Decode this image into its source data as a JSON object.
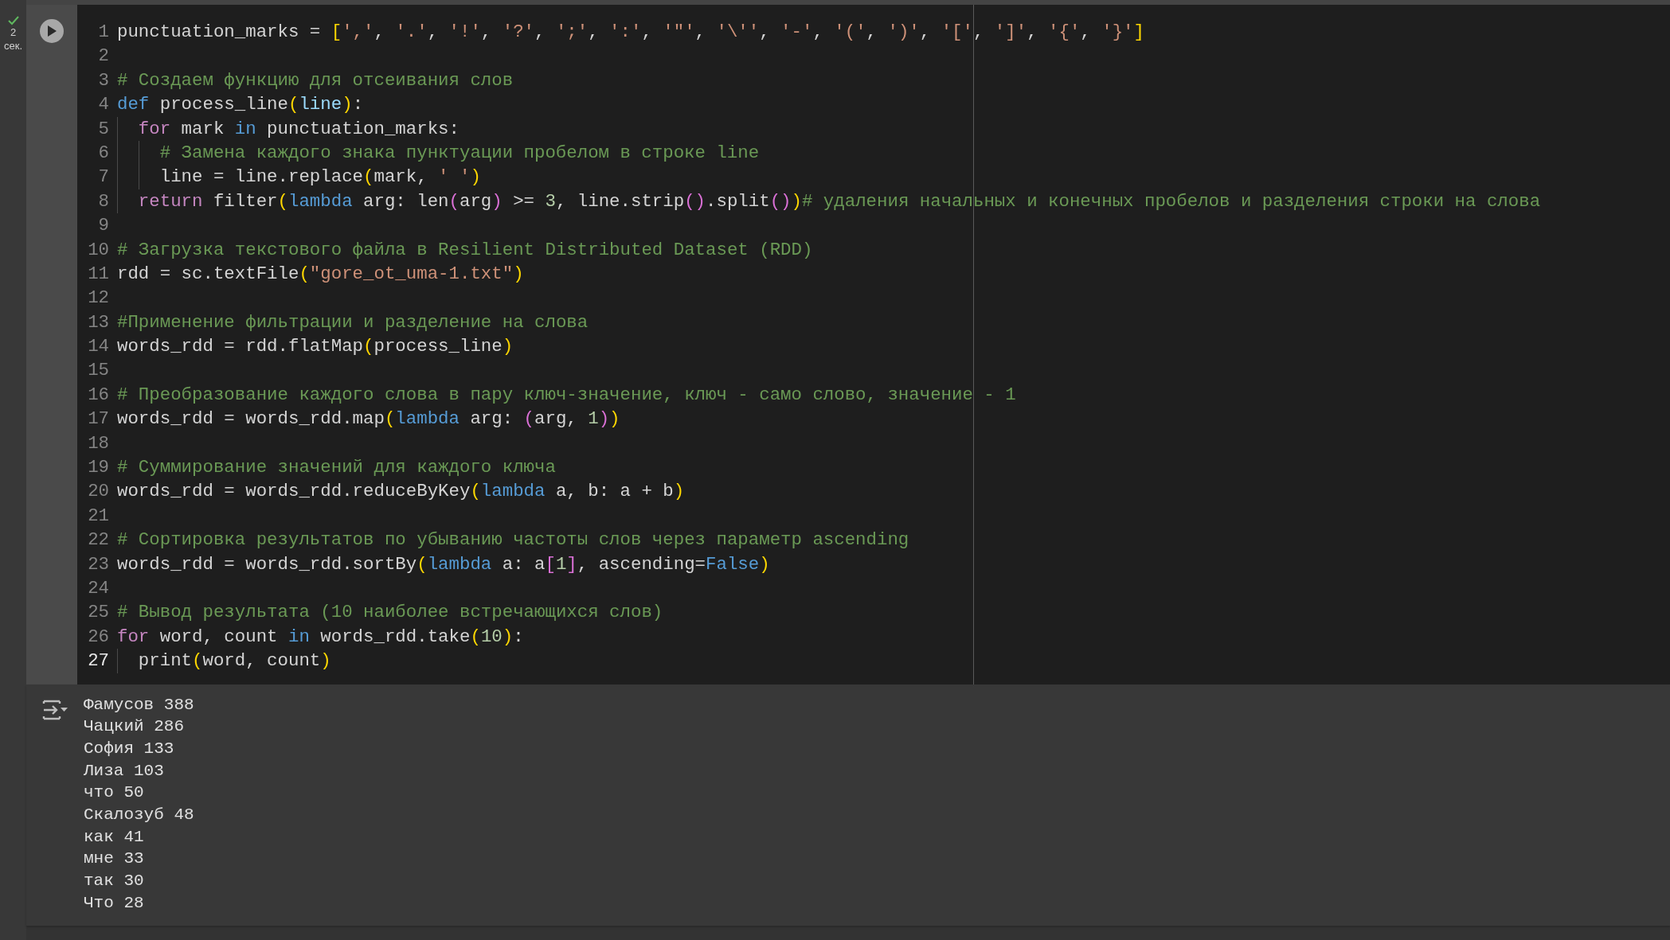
{
  "cell": {
    "status": {
      "done": true,
      "duration": "2",
      "unit": "сек."
    },
    "code_lines": [
      {
        "number": "1",
        "current": false,
        "tokens": [
          {
            "kind": "plain",
            "text": "punctuation_marks = "
          },
          {
            "kind": "bracket1",
            "text": "["
          },
          {
            "kind": "string",
            "text": "','"
          },
          {
            "kind": "plain",
            "text": ", "
          },
          {
            "kind": "string",
            "text": "'.'"
          },
          {
            "kind": "plain",
            "text": ", "
          },
          {
            "kind": "string",
            "text": "'!'"
          },
          {
            "kind": "plain",
            "text": ", "
          },
          {
            "kind": "string",
            "text": "'?'"
          },
          {
            "kind": "plain",
            "text": ", "
          },
          {
            "kind": "string",
            "text": "';'"
          },
          {
            "kind": "plain",
            "text": ", "
          },
          {
            "kind": "string",
            "text": "':'"
          },
          {
            "kind": "plain",
            "text": ", "
          },
          {
            "kind": "string",
            "text": "'\"'"
          },
          {
            "kind": "plain",
            "text": ", "
          },
          {
            "kind": "string",
            "text": "'\\''"
          },
          {
            "kind": "plain",
            "text": ", "
          },
          {
            "kind": "string",
            "text": "'-'"
          },
          {
            "kind": "plain",
            "text": ", "
          },
          {
            "kind": "string",
            "text": "'('"
          },
          {
            "kind": "plain",
            "text": ", "
          },
          {
            "kind": "string",
            "text": "')'"
          },
          {
            "kind": "plain",
            "text": ", "
          },
          {
            "kind": "string",
            "text": "'['"
          },
          {
            "kind": "plain",
            "text": ", "
          },
          {
            "kind": "string",
            "text": "']'"
          },
          {
            "kind": "plain",
            "text": ", "
          },
          {
            "kind": "string",
            "text": "'{'"
          },
          {
            "kind": "plain",
            "text": ", "
          },
          {
            "kind": "string",
            "text": "'}'"
          },
          {
            "kind": "bracket1",
            "text": "]"
          }
        ]
      },
      {
        "number": "2",
        "current": false
      },
      {
        "number": "3",
        "current": false,
        "tokens": [
          {
            "kind": "comment",
            "text": "# Создаем функцию для отсеивания слов"
          }
        ]
      },
      {
        "number": "4",
        "current": false,
        "tokens": [
          {
            "kind": "keyword2",
            "text": "def"
          },
          {
            "kind": "plain",
            "text": " process_line"
          },
          {
            "kind": "bracket1",
            "text": "("
          },
          {
            "kind": "param",
            "text": "line"
          },
          {
            "kind": "bracket1",
            "text": ")"
          },
          {
            "kind": "plain",
            "text": ":"
          }
        ]
      },
      {
        "number": "5",
        "current": false,
        "tokens": [
          {
            "kind": "keyword1",
            "text": "  for"
          },
          {
            "kind": "plain",
            "text": " mark "
          },
          {
            "kind": "keyword2",
            "text": "in"
          },
          {
            "kind": "plain",
            "text": " punctuation_marks:"
          }
        ]
      },
      {
        "number": "6",
        "current": false,
        "tokens": [
          {
            "kind": "comment",
            "text": "    # Замена каждого знака пунктуации пробелом в строке line"
          }
        ]
      },
      {
        "number": "7",
        "current": false,
        "tokens": [
          {
            "kind": "plain",
            "text": "    line = line.replace"
          },
          {
            "kind": "bracket1",
            "text": "("
          },
          {
            "kind": "plain",
            "text": "mark, "
          },
          {
            "kind": "string",
            "text": "' '"
          },
          {
            "kind": "bracket1",
            "text": ")"
          }
        ]
      },
      {
        "number": "8",
        "current": false,
        "tokens": [
          {
            "kind": "keyword1",
            "text": "  return"
          },
          {
            "kind": "plain",
            "text": " filter"
          },
          {
            "kind": "bracket1",
            "text": "("
          },
          {
            "kind": "keyword2",
            "text": "lambda"
          },
          {
            "kind": "plain",
            "text": " arg: len"
          },
          {
            "kind": "bracket2",
            "text": "("
          },
          {
            "kind": "plain",
            "text": "arg"
          },
          {
            "kind": "bracket2",
            "text": ")"
          },
          {
            "kind": "plain",
            "text": " >= "
          },
          {
            "kind": "number",
            "text": "3"
          },
          {
            "kind": "plain",
            "text": ", line.strip"
          },
          {
            "kind": "bracket2",
            "text": "()"
          },
          {
            "kind": "plain",
            "text": ".split"
          },
          {
            "kind": "bracket2",
            "text": "()"
          },
          {
            "kind": "bracket1",
            "text": ")"
          },
          {
            "kind": "comment",
            "text": "# удаления начальных и конечных пробелов и разделения строки на слова"
          }
        ]
      },
      {
        "number": "9",
        "current": false
      },
      {
        "number": "10",
        "current": false,
        "tokens": [
          {
            "kind": "comment",
            "text": "# Загрузка текстового файла в Resilient Distributed Dataset (RDD)"
          }
        ]
      },
      {
        "number": "11",
        "current": false,
        "tokens": [
          {
            "kind": "plain",
            "text": "rdd = sc.textFile"
          },
          {
            "kind": "bracket1",
            "text": "("
          },
          {
            "kind": "string",
            "text": "\"gore_ot_uma-1.txt\""
          },
          {
            "kind": "bracket1",
            "text": ")"
          }
        ]
      },
      {
        "number": "12",
        "current": false
      },
      {
        "number": "13",
        "current": false,
        "tokens": [
          {
            "kind": "comment",
            "text": "#Применение фильтрации и разделение на слова"
          }
        ]
      },
      {
        "number": "14",
        "current": false,
        "tokens": [
          {
            "kind": "plain",
            "text": "words_rdd = rdd.flatMap"
          },
          {
            "kind": "bracket1",
            "text": "("
          },
          {
            "kind": "plain",
            "text": "process_line"
          },
          {
            "kind": "bracket1",
            "text": ")"
          }
        ]
      },
      {
        "number": "15",
        "current": false
      },
      {
        "number": "16",
        "current": false,
        "tokens": [
          {
            "kind": "comment",
            "text": "# Преобразование каждого слова в пару ключ-значение, ключ - само слово, значение - 1"
          }
        ]
      },
      {
        "number": "17",
        "current": false,
        "tokens": [
          {
            "kind": "plain",
            "text": "words_rdd = words_rdd.map"
          },
          {
            "kind": "bracket1",
            "text": "("
          },
          {
            "kind": "keyword2",
            "text": "lambda"
          },
          {
            "kind": "plain",
            "text": " arg: "
          },
          {
            "kind": "bracket2",
            "text": "("
          },
          {
            "kind": "plain",
            "text": "arg, "
          },
          {
            "kind": "number",
            "text": "1"
          },
          {
            "kind": "bracket2",
            "text": ")"
          },
          {
            "kind": "bracket1",
            "text": ")"
          }
        ]
      },
      {
        "number": "18",
        "current": false
      },
      {
        "number": "19",
        "current": false,
        "tokens": [
          {
            "kind": "comment",
            "text": "# Суммирование значений для каждого ключа"
          }
        ]
      },
      {
        "number": "20",
        "current": false,
        "tokens": [
          {
            "kind": "plain",
            "text": "words_rdd = words_rdd.reduceByKey"
          },
          {
            "kind": "bracket1",
            "text": "("
          },
          {
            "kind": "keyword2",
            "text": "lambda"
          },
          {
            "kind": "plain",
            "text": " a, b: a + b"
          },
          {
            "kind": "bracket1",
            "text": ")"
          }
        ]
      },
      {
        "number": "21",
        "current": false
      },
      {
        "number": "22",
        "current": false,
        "tokens": [
          {
            "kind": "comment",
            "text": "# Сортировка результатов по убыванию частоты слов через параметр ascending"
          }
        ]
      },
      {
        "number": "23",
        "current": false,
        "tokens": [
          {
            "kind": "plain",
            "text": "words_rdd = words_rdd.sortBy"
          },
          {
            "kind": "bracket1",
            "text": "("
          },
          {
            "kind": "keyword2",
            "text": "lambda"
          },
          {
            "kind": "plain",
            "text": " a: a"
          },
          {
            "kind": "bracket2",
            "text": "["
          },
          {
            "kind": "number",
            "text": "1"
          },
          {
            "kind": "bracket2",
            "text": "]"
          },
          {
            "kind": "plain",
            "text": ", ascending="
          },
          {
            "kind": "keyword2",
            "text": "False"
          },
          {
            "kind": "bracket1",
            "text": ")"
          }
        ]
      },
      {
        "number": "24",
        "current": false
      },
      {
        "number": "25",
        "current": false,
        "tokens": [
          {
            "kind": "comment",
            "text": "# Вывод результата (10 наиболее встречающихся слов)"
          }
        ]
      },
      {
        "number": "26",
        "current": false,
        "tokens": [
          {
            "kind": "keyword1",
            "text": "for"
          },
          {
            "kind": "plain",
            "text": " word, count "
          },
          {
            "kind": "keyword2",
            "text": "in"
          },
          {
            "kind": "plain",
            "text": " words_rdd.take"
          },
          {
            "kind": "bracket1",
            "text": "("
          },
          {
            "kind": "number",
            "text": "10"
          },
          {
            "kind": "bracket1",
            "text": ")"
          },
          {
            "kind": "plain",
            "text": ":"
          }
        ]
      },
      {
        "number": "27",
        "current": true,
        "tokens": [
          {
            "kind": "plain",
            "text": "  print"
          },
          {
            "kind": "bracket1",
            "text": "("
          },
          {
            "kind": "plain",
            "text": "word, count"
          },
          {
            "kind": "bracket1",
            "text": ")"
          }
        ]
      }
    ],
    "output": [
      "Фамусов 388",
      "Чацкий 286",
      "София 133",
      "Лиза 103",
      "что 50",
      "Скалозуб 48",
      "как 41",
      "мне 33",
      "так 30",
      "Что 28"
    ]
  }
}
